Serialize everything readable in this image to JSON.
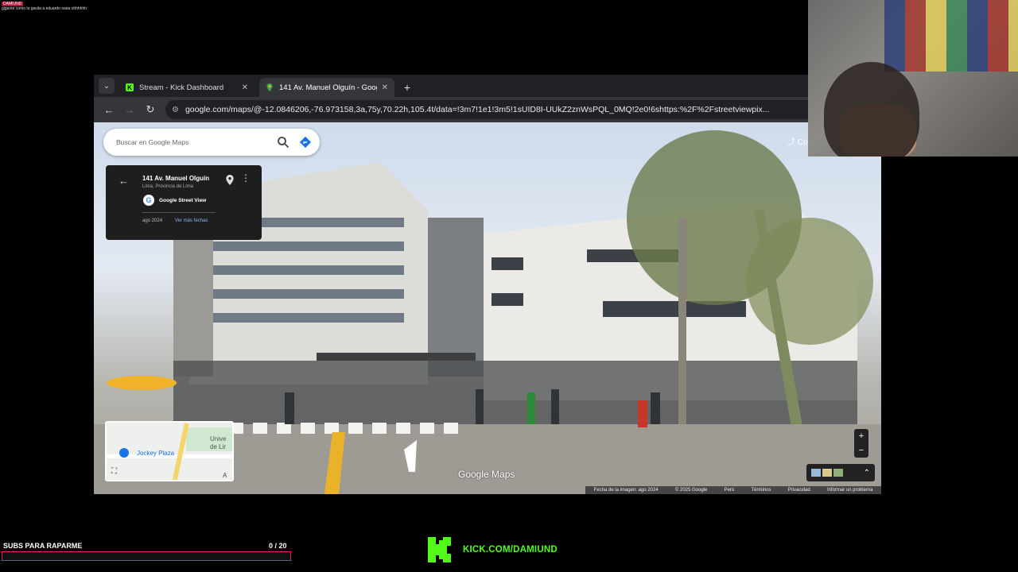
{
  "chat": {
    "username": "DAMIUND",
    "message": "gigante como la gasita a eduardo osea ohhhhhh"
  },
  "browser": {
    "tabs": [
      {
        "title": "Stream - Kick Dashboard",
        "close": "✕"
      },
      {
        "title": "141 Av. Manuel Olguín - Google Maps",
        "close": "✕"
      }
    ],
    "new_tab": "+",
    "tab_menu": "⌄",
    "url": "google.com/maps/@-12.0846206,-76.973158,3a,75y,70.22h,105.4t/data=!3m7!1e1!3m5!1sUID8I-UUkZ2znWsPQL_0MQ!2e0!6shttps:%2F%2Fstreetviewpix..."
  },
  "maps": {
    "search_placeholder": "Buscar en Google Maps",
    "place_title": "141 Av. Manuel Olguín",
    "place_subtitle": "Lima, Provincia de Lima",
    "source": "Google Street View",
    "capture_date": "ago 2024",
    "more_dates": "Ver más fechas",
    "share_label": "Co",
    "watermark": "Google Maps",
    "minimap_label_1": "Jockey Plaza",
    "minimap_label_2": "Unive de Lir",
    "footer": {
      "image_date": "Fecha de la imagen: ago 2024",
      "copyright": "© 2025 Google",
      "country": "Perú",
      "terms": "Términos",
      "privacy": "Privacidad",
      "report": "Informar un problema"
    }
  },
  "overlay": {
    "subs_label": "SUBS PARA RAPARME",
    "subs_count": "0 / 20",
    "subs_progress": 0,
    "kick_url": "KICK.COM/DAMIUND",
    "kick_color": "#53fc18",
    "bar_color": "#e0217e"
  }
}
